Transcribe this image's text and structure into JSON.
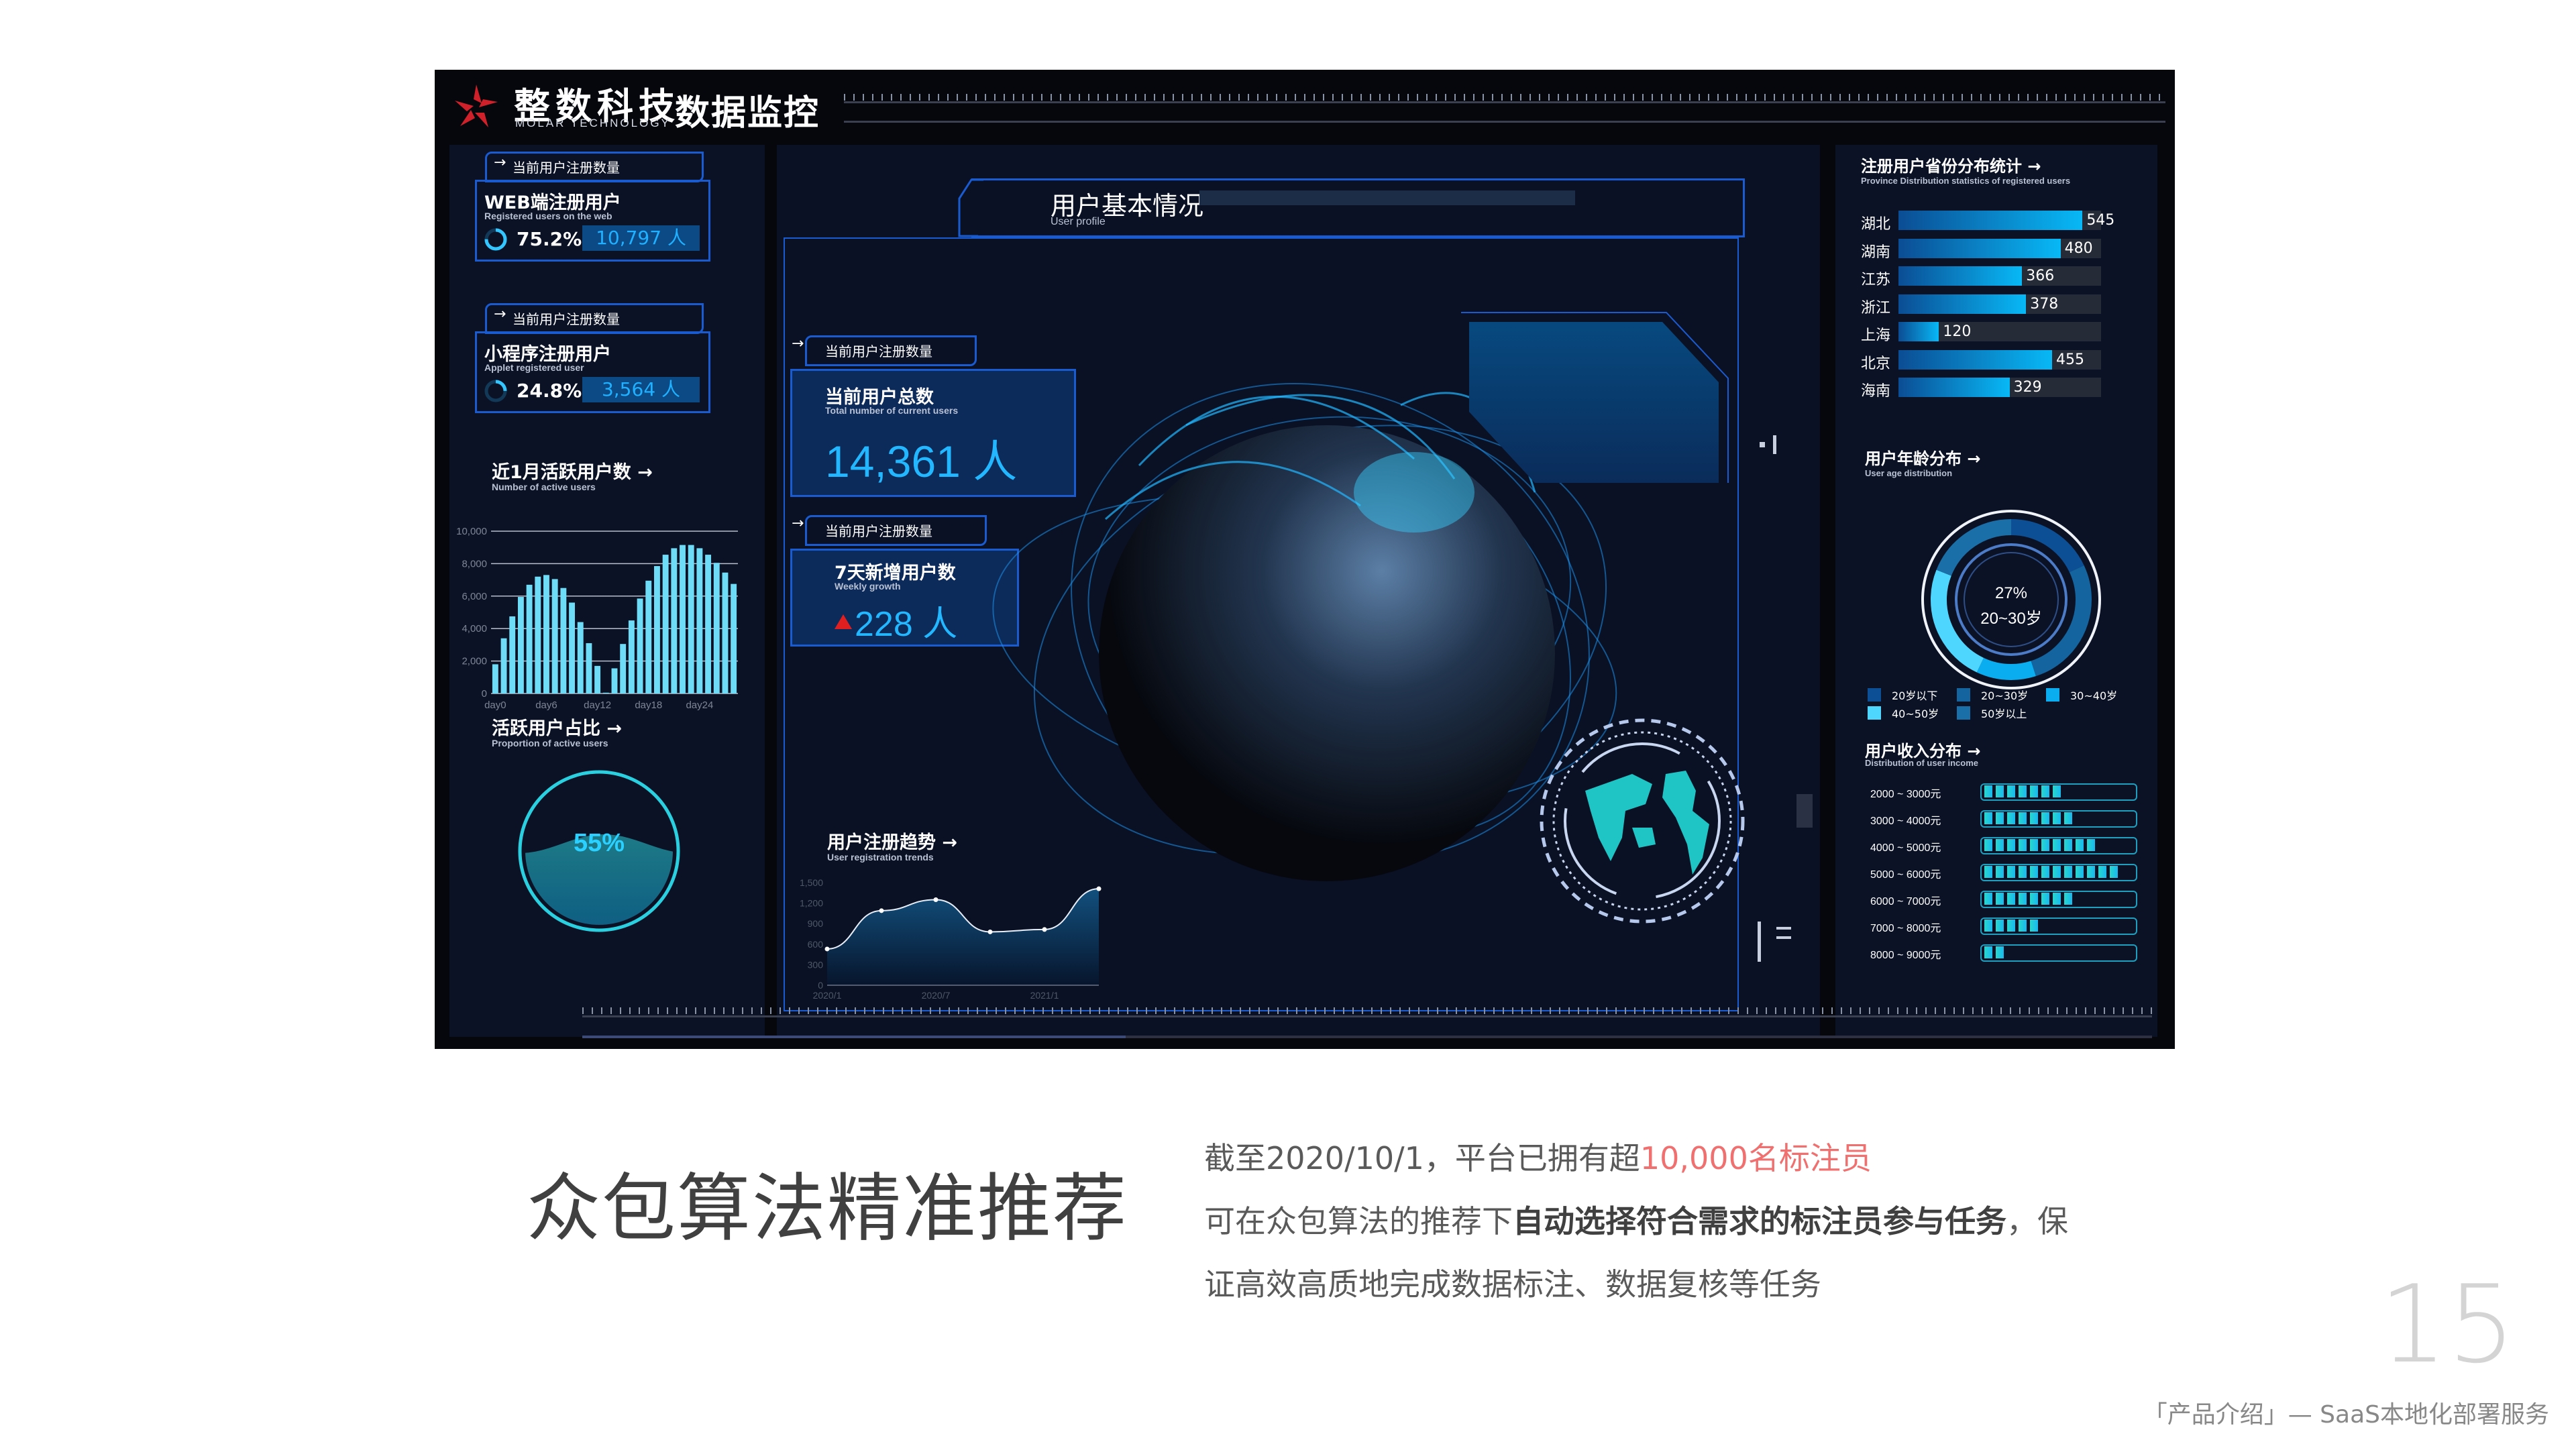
{
  "dashboard": {
    "brand_cn": "整数科技",
    "brand_en": "MOLAR TECHNOLOGY",
    "screen_title": "数据监控",
    "left": {
      "web_card": {
        "tab_label": "当前用户注册数量",
        "title": "WEB端注册用户",
        "subtitle": "Registered users on the web",
        "percent": "75.2%",
        "percent_value": 0.752,
        "count": "10,797 人"
      },
      "applet_card": {
        "tab_label": "当前用户注册数量",
        "title": "小程序注册用户",
        "subtitle": "Applet registered user",
        "percent": "24.8%",
        "percent_value": 0.248,
        "count": "3,564 人"
      },
      "active_users": {
        "title": "近1月活跃用户数",
        "subtitle": "Number of active users"
      },
      "active_ratio": {
        "title": "活跃用户占比",
        "subtitle": "Proportion of active users",
        "value_label": "55%",
        "value": 0.55
      }
    },
    "center": {
      "section_title": "用户基本情况",
      "section_subtitle": "User profile",
      "total_card": {
        "tab_label": "当前用户注册数量",
        "title": "当前用户总数",
        "subtitle": "Total number of current users",
        "value": "14,361 人"
      },
      "weekly_card": {
        "tab_label": "当前用户注册数量",
        "title": "7天新增用户数",
        "subtitle": "Weekly growth",
        "value": "228 人",
        "trend": "up"
      },
      "trend": {
        "title": "用户注册趋势",
        "subtitle": "User registration trends"
      }
    },
    "right": {
      "province": {
        "title": "注册用户省份分布统计",
        "subtitle": "Province Distribution statistics of registered users"
      },
      "age": {
        "title": "用户年龄分布",
        "subtitle": "User age distribution",
        "center_percent": "27%",
        "center_label": "20~30岁"
      },
      "income": {
        "title": "用户收入分布",
        "subtitle": "Distribution of user income"
      }
    },
    "colors": {
      "accent": "#23b7ff",
      "bar": "#6fdcf7",
      "brand_red": "#d0202a",
      "trend_up": "#e02020"
    }
  },
  "chart_data": [
    {
      "id": "active_users",
      "type": "bar",
      "title": "近1月活跃用户数",
      "xlabel": "",
      "ylabel": "",
      "ylim": [
        0,
        10000
      ],
      "yticks": [
        "0",
        "2,000",
        "4,000",
        "6,000",
        "8,000",
        "10,000"
      ],
      "xtick_labels": [
        "day0",
        "day6",
        "day12",
        "day18",
        "day24"
      ],
      "categories": [
        "day0",
        "day1",
        "day2",
        "day3",
        "day4",
        "day5",
        "day6",
        "day7",
        "day8",
        "day9",
        "day10",
        "day11",
        "day12",
        "day13",
        "day14",
        "day15",
        "day16",
        "day17",
        "day18",
        "day19",
        "day20",
        "day21",
        "day22",
        "day23",
        "day24",
        "day25",
        "day26",
        "day27",
        "day28"
      ],
      "values": [
        1800,
        3400,
        4750,
        5950,
        6700,
        7200,
        7300,
        7050,
        6500,
        5600,
        4400,
        3100,
        1700,
        50,
        1550,
        3050,
        4500,
        5850,
        6950,
        7850,
        8550,
        8950,
        9150,
        9150,
        8950,
        8550,
        8050,
        7450,
        6750
      ],
      "grid": true
    },
    {
      "id": "registration_trend",
      "type": "area",
      "title": "用户注册趋势",
      "ylim": [
        0,
        1500
      ],
      "yticks": [
        "0",
        "300",
        "600",
        "900",
        "1,200",
        "1,500"
      ],
      "xtick_labels": [
        "2020/1",
        "2020/7",
        "2021/1"
      ],
      "x": [
        "2020/1",
        "2020/4",
        "2020/7",
        "2020/10",
        "2021/1",
        "2021/4"
      ],
      "values": [
        530,
        1090,
        1250,
        780,
        815,
        1410
      ]
    },
    {
      "id": "province",
      "type": "bar",
      "orientation": "horizontal",
      "title": "注册用户省份分布统计",
      "xlim": [
        0,
        600
      ],
      "categories": [
        "湖北",
        "湖南",
        "江苏",
        "浙江",
        "上海",
        "北京",
        "海南"
      ],
      "values": [
        545,
        480,
        366,
        378,
        120,
        455,
        329
      ]
    },
    {
      "id": "age",
      "type": "pie",
      "title": "用户年龄分布",
      "legend": [
        "20岁以下",
        "20~30岁",
        "30~40岁",
        "40~50岁",
        "50岁以上"
      ],
      "legend_colors": [
        "#0d4f94",
        "#13649f",
        "#0aaef0",
        "#4fd6ff",
        "#1a6fa8"
      ],
      "values": [
        18,
        27,
        12,
        24,
        19
      ],
      "center_label": "27% 20~30岁",
      "legend_position": "bottom"
    },
    {
      "id": "income",
      "type": "bar",
      "orientation": "horizontal",
      "title": "用户收入分布",
      "categories": [
        "2000 ~ 3000元",
        "3000 ~ 4000元",
        "4000 ~ 5000元",
        "5000 ~ 6000元",
        "6000 ~ 7000元",
        "7000 ~ 8000元",
        "8000 ~ 9000元"
      ],
      "values": [
        0.47,
        0.6,
        0.7,
        0.88,
        0.54,
        0.36,
        0.14
      ],
      "xlim": [
        0,
        1
      ]
    }
  ],
  "slide": {
    "heading": "众包算法精准推荐",
    "para_line1_pre": "截至2020/10/1，平台已拥有超",
    "para_line1_highlight": "10,000名标注员",
    "para_line2_pre": "可在众包算法的推荐下",
    "para_line2_bold": "自动选择符合需求的标注员参与任务",
    "para_line2_post": "，保",
    "para_line3": "证高效高质地完成数据标注、数据复核等任务",
    "page_number": "15",
    "footer": "「产品介绍」— SaaS本地化部署服务",
    "highlight_color": "#f07070"
  }
}
